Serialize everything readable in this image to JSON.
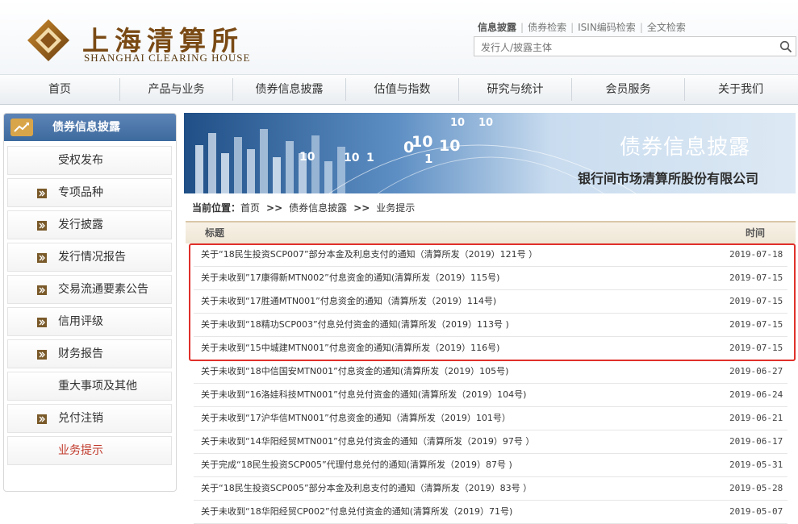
{
  "header": {
    "logo_cn": "上海清算所",
    "logo_en": "SHANGHAI CLEARING HOUSE",
    "top_links": [
      "信息披露",
      "债券检索",
      "ISIN编码检索",
      "全文检索"
    ],
    "search_placeholder": "发行人/披露主体"
  },
  "nav": [
    "首页",
    "产品与业务",
    "债券信息披露",
    "估值与指数",
    "研究与统计",
    "会员服务",
    "关于我们"
  ],
  "sidebar": {
    "title": "债券信息披露",
    "items": [
      {
        "label": "受权发布",
        "bullet": false
      },
      {
        "label": "专项品种",
        "bullet": true
      },
      {
        "label": "发行披露",
        "bullet": true
      },
      {
        "label": "发行情况报告",
        "bullet": true
      },
      {
        "label": "交易流通要素公告",
        "bullet": true
      },
      {
        "label": "信用评级",
        "bullet": true
      },
      {
        "label": "财务报告",
        "bullet": true
      },
      {
        "label": "重大事项及其他",
        "bullet": false
      },
      {
        "label": "兑付注销",
        "bullet": true
      },
      {
        "label": "业务提示",
        "bullet": false
      }
    ]
  },
  "banner": {
    "title": "债券信息披露",
    "subtitle": "银行间市场清算所股份有限公司",
    "bg_digits": [
      "10",
      "10",
      "10",
      "1",
      "0",
      "10",
      "10",
      "10",
      "1"
    ]
  },
  "breadcrumb": {
    "label": "当前位置：",
    "crumbs": [
      "首页",
      "债券信息披露",
      "业务提示"
    ],
    "sep": ">>"
  },
  "table": {
    "col_title": "标题",
    "col_time": "时间",
    "rows": [
      {
        "title": "关于“18民生投资SCP007”部分本金及利息支付的通知（清算所发（2019）121号 ）",
        "date": "2019-07-18"
      },
      {
        "title": "关于未收到”17康得新MTN002”付息资金的通知(清算所发（2019）115号)",
        "date": "2019-07-15"
      },
      {
        "title": "关于未收到“17胜通MTN001”付息资金的通知（清算所发（2019）114号)",
        "date": "2019-07-15"
      },
      {
        "title": "关于未收到“18精功SCP003”付息兑付资金的通知(清算所发（2019）113号 )",
        "date": "2019-07-15"
      },
      {
        "title": "关于未收到“15中城建MTN001”付息资金的通知(清算所发（2019）116号)",
        "date": "2019-07-15"
      },
      {
        "title": "关于未收到“18中信国安MTN001”付息资金的通知(清算所发（2019）105号)",
        "date": "2019-06-27"
      },
      {
        "title": "关于未收到“16洛娃科技MTN001”付息兑付资金的通知(清算所发（2019）104号)",
        "date": "2019-06-24"
      },
      {
        "title": "关于未收到“17沪华信MTN001”付息资金的通知（清算所发（2019）101号）",
        "date": "2019-06-21"
      },
      {
        "title": "关于未收到“14华阳经贸MTN001”付息兑付资金的通知（清算所发（2019）97号 ）",
        "date": "2019-06-17"
      },
      {
        "title": "关于完成“18民生投资SCP005”代理付息兑付的通知(清算所发（2019）87号 )",
        "date": "2019-05-31"
      },
      {
        "title": "关于“18民生投资SCP005”部分本金及利息支付的通知（清算所发（2019）83号 ）",
        "date": "2019-05-28"
      },
      {
        "title": "关于未收到“18华阳经贸CP002”付息兑付资金的通知(清算所发（2019）71号)",
        "date": "2019-05-07"
      }
    ]
  },
  "colors": {
    "accent": "#3d6a9e",
    "highlight": "#e0302a",
    "active_text": "#c0392b",
    "brand_brown": "#7a4a15"
  }
}
